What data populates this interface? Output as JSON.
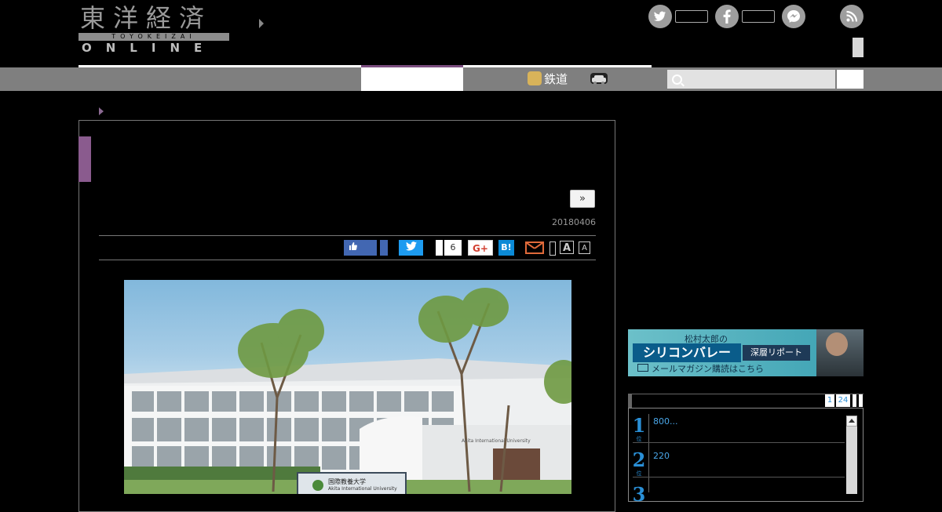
{
  "header": {
    "logo_kanji": "東洋経済",
    "logo_romaji": "TOYOKEIZAI",
    "logo_online": "ONLINE"
  },
  "social": {
    "twitter_icon": "twitter-icon",
    "facebook_icon": "facebook-icon",
    "messenger_icon": "messenger-icon",
    "rss_icon": "rss-icon"
  },
  "nav": {
    "rail_label": "鉄道",
    "search_placeholder": ""
  },
  "article": {
    "next_label": "»",
    "date": "20180406",
    "share": {
      "like_label": "",
      "tweet_label": "",
      "count": "6",
      "gplus_label": "G+",
      "hatena_label": "B!",
      "font_large": "A",
      "font_small": "A"
    },
    "photo": {
      "sign_jp": "国際教養大学",
      "sign_en": "Akita International University",
      "building_text": "Akita International University"
    }
  },
  "sidebar": {
    "banner": {
      "subtitle": "松村太郎の",
      "title": "シリコンバレー",
      "deep": "深層リポート",
      "mag": "メールマガジン購読はこちら"
    },
    "ranking": {
      "pages": [
        "1",
        "24"
      ],
      "items": [
        {
          "rank": "1",
          "sub": "位",
          "text": "800..."
        },
        {
          "rank": "2",
          "sub": "位",
          "text": "220"
        },
        {
          "rank": "3",
          "sub": "",
          "text": ""
        }
      ]
    }
  }
}
